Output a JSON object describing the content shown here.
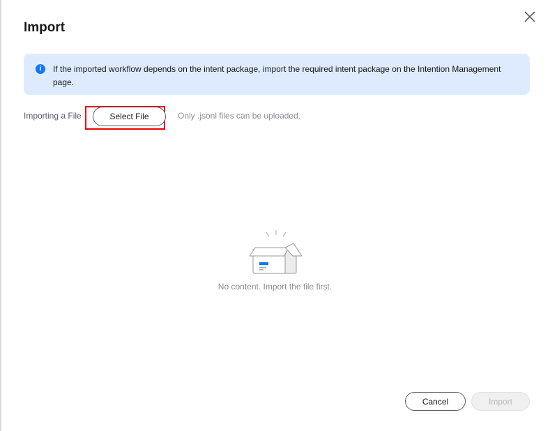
{
  "dialog": {
    "title": "Import",
    "alert": "If the imported workflow depends on the intent package, import the required intent package on the Intention Management page.",
    "file_label": "Importing a File",
    "select_file": "Select File",
    "hint": "Only .jsonl files can be uploaded.",
    "empty": "No content. Import the file first.",
    "cancel": "Cancel",
    "import": "Import"
  }
}
